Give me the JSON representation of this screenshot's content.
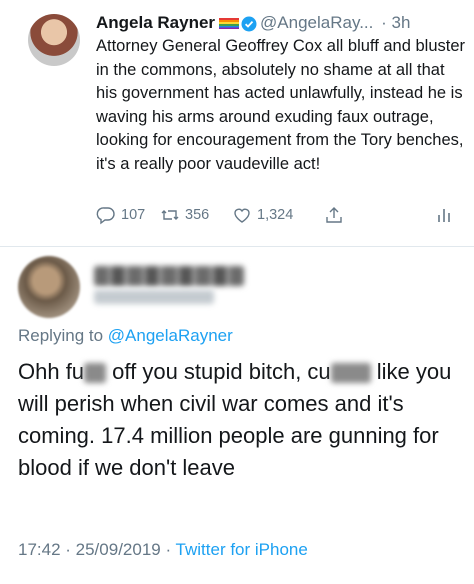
{
  "tweet": {
    "author_name": "Angela Rayner",
    "handle": "@AngelaRay...",
    "time": "· 3h",
    "text": "Attorney General Geoffrey Cox all bluff and bluster in the commons, absolutely no shame at all that his government has acted unlawfully, instead he is waving his arms around exuding faux outrage, looking for encouragement from the Tory benches, it's a really poor vaudeville act!",
    "replies": "107",
    "retweets": "356",
    "likes": "1,324",
    "icons": [
      "reply-icon",
      "retweet-icon",
      "like-icon",
      "share-icon",
      "analytics-icon"
    ]
  },
  "reply": {
    "replying_prefix": "Replying to",
    "replying_handle": "@AngelaRayner",
    "text_part1": "Ohh fu",
    "text_part2": " off you stupid bitch, cu",
    "text_part3": " like you will perish when civil war comes and it's coming. 17.4 million people are gunning for blood if we don't leave",
    "timestamp": "17:42 · 25/09/2019 ·",
    "source": "Twitter for iPhone"
  },
  "colors": {
    "text": "#14171a",
    "secondary": "#657786",
    "link": "#1da1f2",
    "divider": "#e1e8ed"
  }
}
